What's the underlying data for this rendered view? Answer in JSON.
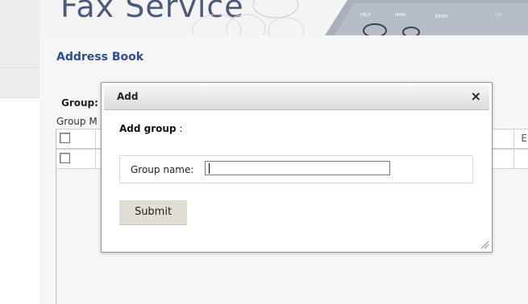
{
  "banner": {
    "title": "Fax Service"
  },
  "page": {
    "heading": "Address Book"
  },
  "group": {
    "label": "Group:"
  },
  "group_members": {
    "label": "Group M"
  },
  "table": {
    "header_partial": "E",
    "rows": [
      {
        "checked": false
      },
      {
        "checked": false
      }
    ]
  },
  "modal": {
    "title": "Add",
    "close_glyph": "×",
    "section_bold": "Add group",
    "section_suffix": " :",
    "field_label": "Group name:",
    "field_value": "",
    "submit_label": "Submit"
  }
}
